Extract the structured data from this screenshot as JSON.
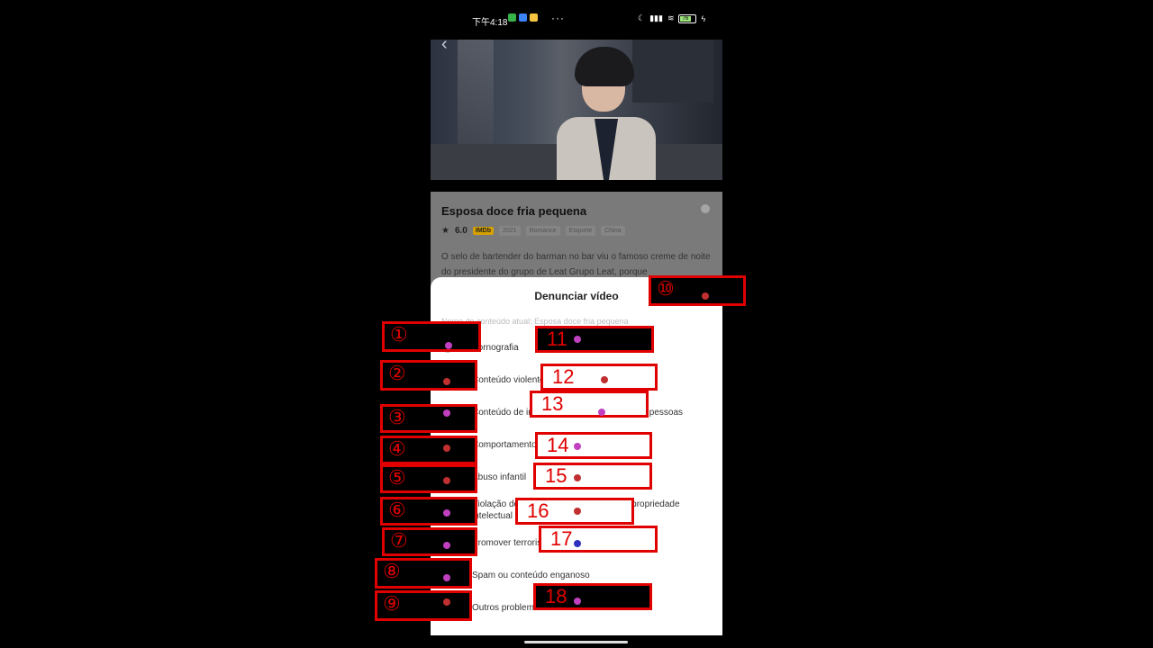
{
  "status_bar": {
    "time": "下午4:18",
    "more": "···",
    "battery_level": "76",
    "app_colors": [
      "#37b34a",
      "#3b82f6",
      "#f5c542"
    ]
  },
  "video": {
    "back_icon": "chevron-left-icon"
  },
  "show": {
    "title": "Esposa doce fria pequena",
    "rating": "6.0",
    "imdb": "IMDb",
    "tags": [
      "2021",
      "Romance",
      "Esquete",
      "China"
    ],
    "description": "O selo de bartender do barman no bar viu o famoso creme de noite do presidente do grupo de Leat Grupo Leat, porque"
  },
  "report_modal": {
    "title": "Denunciar vídeo",
    "current_prefix": "Nome do conteúdo atual: Esposa doce fria pequena",
    "close_icon": "close-icon",
    "options": [
      "Pornografia",
      "Conteúdo violento ou ofensivo",
      "Conteúdo de incitação ao ódio ou insulto às pessoas",
      "Comportamento prejudicial ou perigoso",
      "Abuso infantil",
      "Violação de direitos autorais/direitos de propriedade intelectual",
      "Promover terrorismo",
      "Spam ou conteúdo enganoso",
      "Outros problemas"
    ]
  },
  "annotations": {
    "left_numbers": [
      "①",
      "②",
      "③",
      "④",
      "⑤",
      "⑥",
      "⑦",
      "⑧",
      "⑨"
    ],
    "close_number": "⑩",
    "right_numbers": [
      "11",
      "12",
      "13",
      "14",
      "15",
      "16",
      "17",
      "18"
    ],
    "colors": {
      "box": "#e00000",
      "magenta": "#c040c0",
      "red": "#c03030",
      "blue": "#3030c0"
    }
  }
}
